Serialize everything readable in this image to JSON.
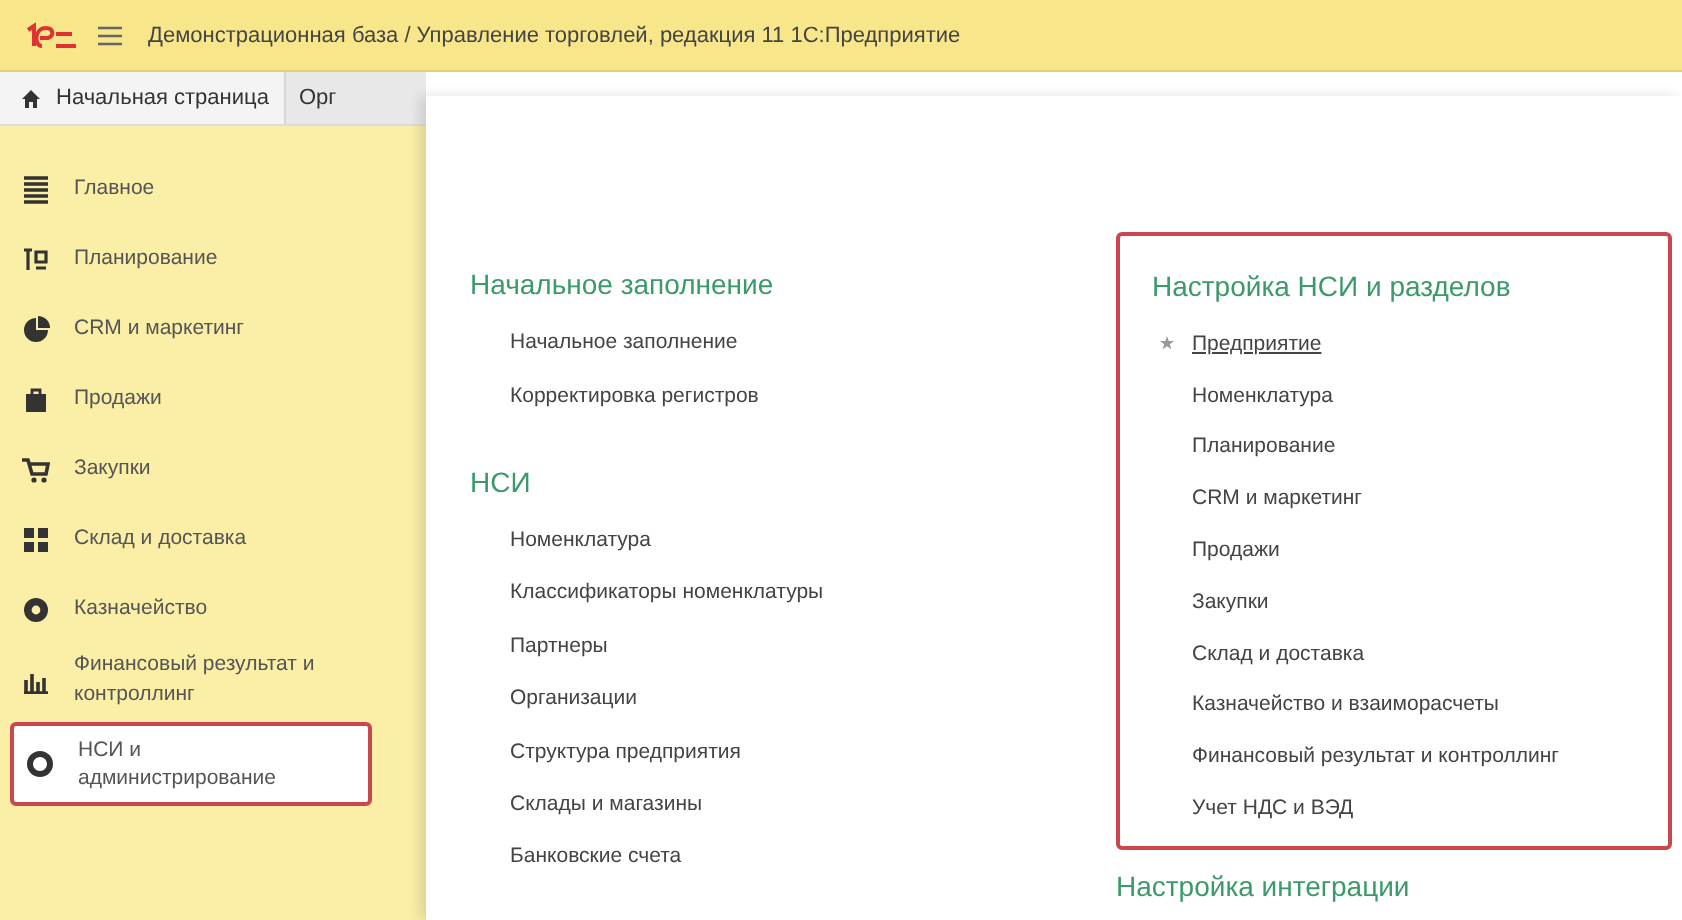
{
  "window": {
    "title": "Демонстрационная база / Управление торговлей, редакция 11 1С:Предприятие"
  },
  "tabs": [
    {
      "label": "Начальная страница",
      "selected": true
    },
    {
      "label": "Орг",
      "selected": false
    }
  ],
  "sidebar": {
    "items": [
      {
        "label": "Главное",
        "selected": false,
        "highlighted": false
      },
      {
        "label": "Планирование",
        "selected": false,
        "highlighted": false
      },
      {
        "label": "CRM и маркетинг",
        "selected": false,
        "highlighted": false
      },
      {
        "label": "Продажи",
        "selected": false,
        "highlighted": false
      },
      {
        "label": "Закупки",
        "selected": false,
        "highlighted": false
      },
      {
        "label": "Склад и доставка",
        "selected": false,
        "highlighted": false
      },
      {
        "label": "Казначейство",
        "selected": false,
        "highlighted": false
      },
      {
        "label": "Финансовый результат и контроллинг",
        "selected": false,
        "highlighted": false
      },
      {
        "label": "НСИ и администрирование",
        "selected": true,
        "highlighted": true
      }
    ]
  },
  "columns": [
    {
      "sections": [
        {
          "title": "Начальное заполнение",
          "highlighted": false,
          "items": [
            {
              "label": "Начальное заполнение",
              "selected": false
            },
            {
              "label": "Корректировка регистров",
              "selected": false
            }
          ]
        },
        {
          "title": "НСИ",
          "highlighted": false,
          "items": [
            {
              "label": "Номенклатура",
              "selected": false
            },
            {
              "label": "Классификаторы номенклатуры",
              "selected": false
            },
            {
              "label": "Партнеры",
              "selected": false
            },
            {
              "label": "Организации",
              "selected": false
            },
            {
              "label": "Структура предприятия",
              "selected": false
            },
            {
              "label": "Склады и магазины",
              "selected": false
            },
            {
              "label": "Банковские счета",
              "selected": false
            }
          ]
        }
      ]
    },
    {
      "sections": [
        {
          "title": "Настройка НСИ и разделов",
          "highlighted": true,
          "items": [
            {
              "label": "Предприятие",
              "selected": true
            },
            {
              "label": "Номенклатура",
              "selected": false
            },
            {
              "label": "Планирование",
              "selected": false
            },
            {
              "label": "CRM и маркетинг",
              "selected": false
            },
            {
              "label": "Продажи",
              "selected": false
            },
            {
              "label": "Закупки",
              "selected": false
            },
            {
              "label": "Склад и доставка",
              "selected": false
            },
            {
              "label": "Казначейство и взаиморасчеты",
              "selected": false
            },
            {
              "label": "Финансовый результат и контроллинг",
              "selected": false
            },
            {
              "label": "Учет НДС и ВЭД",
              "selected": false
            }
          ]
        },
        {
          "title": "Настройка интеграции",
          "highlighted": false
        }
      ]
    }
  ]
}
